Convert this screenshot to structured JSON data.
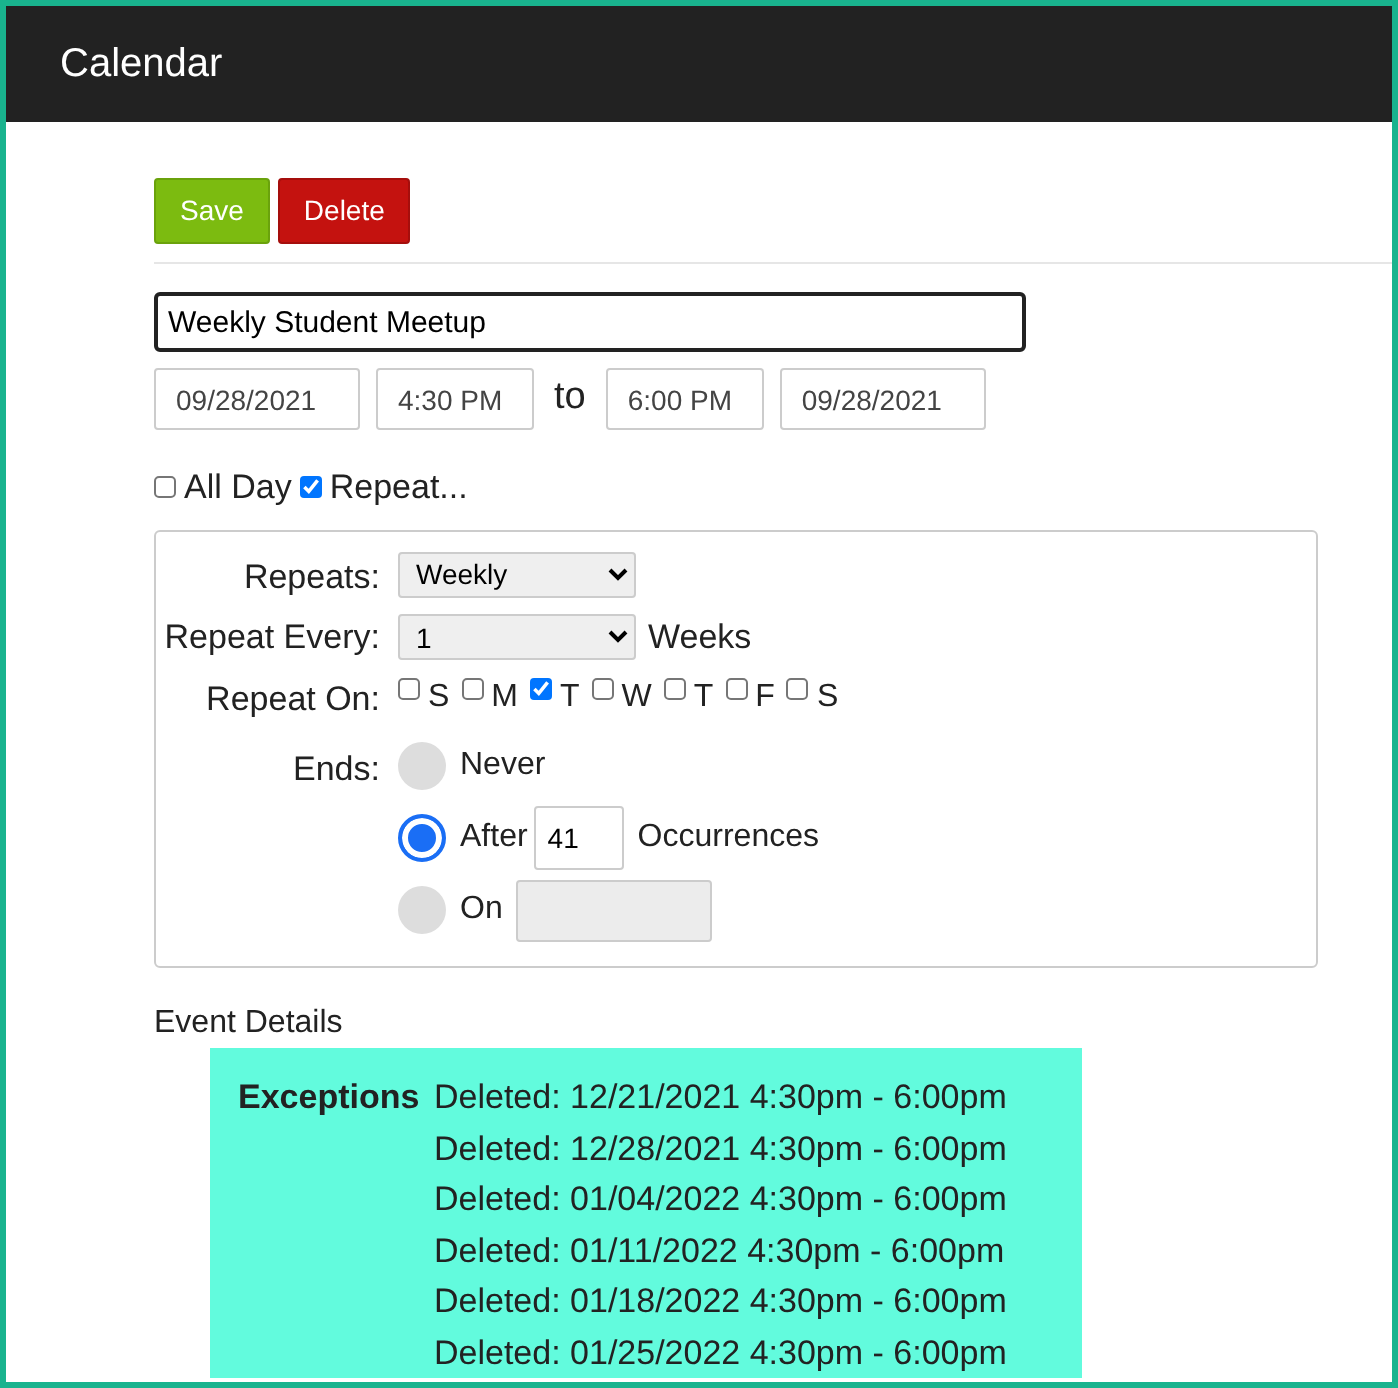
{
  "window": {
    "title": "Calendar"
  },
  "buttons": [
    {
      "label": "Save",
      "kind": "save"
    },
    {
      "label": "Delete",
      "kind": "delete"
    }
  ],
  "event": {
    "title": "Weekly Student Meetup",
    "start_date": "09/28/2021",
    "start_time": "4:30 PM",
    "to_label": "to",
    "end_time": "6:00 PM",
    "end_date": "09/28/2021"
  },
  "options": [
    {
      "label": "All Day",
      "checked": false
    },
    {
      "label": "Repeat...",
      "checked": true
    }
  ],
  "repeat": {
    "repeats_label": "Repeats:",
    "repeats_value": "Weekly",
    "every_label": "Repeat Every:",
    "every_value": "1",
    "every_unit": "Weeks",
    "on_label": "Repeat On:",
    "days": [
      {
        "label": "S",
        "checked": false
      },
      {
        "label": "M",
        "checked": false
      },
      {
        "label": "T",
        "checked": true
      },
      {
        "label": "W",
        "checked": false
      },
      {
        "label": "T",
        "checked": false
      },
      {
        "label": "F",
        "checked": false
      },
      {
        "label": "S",
        "checked": false
      }
    ],
    "ends_label": "Ends:",
    "ends": [
      {
        "kind": "plain",
        "label": "Never",
        "selected": false
      },
      {
        "kind": "count",
        "label": "After",
        "value": "41",
        "suffix": "Occurrences",
        "selected": true
      },
      {
        "kind": "date",
        "label": "On",
        "selected": false,
        "disabled": true
      }
    ]
  },
  "details": {
    "heading": "Event Details",
    "exceptions_label": "Exceptions",
    "exceptions": [
      "Deleted: 12/21/2021 4:30pm - 6:00pm",
      "Deleted: 12/28/2021 4:30pm - 6:00pm",
      "Deleted: 01/04/2022 4:30pm - 6:00pm",
      "Deleted: 01/11/2022 4:30pm - 6:00pm",
      "Deleted: 01/18/2022 4:30pm - 6:00pm",
      "Deleted: 01/25/2022 4:30pm - 6:00pm"
    ]
  }
}
